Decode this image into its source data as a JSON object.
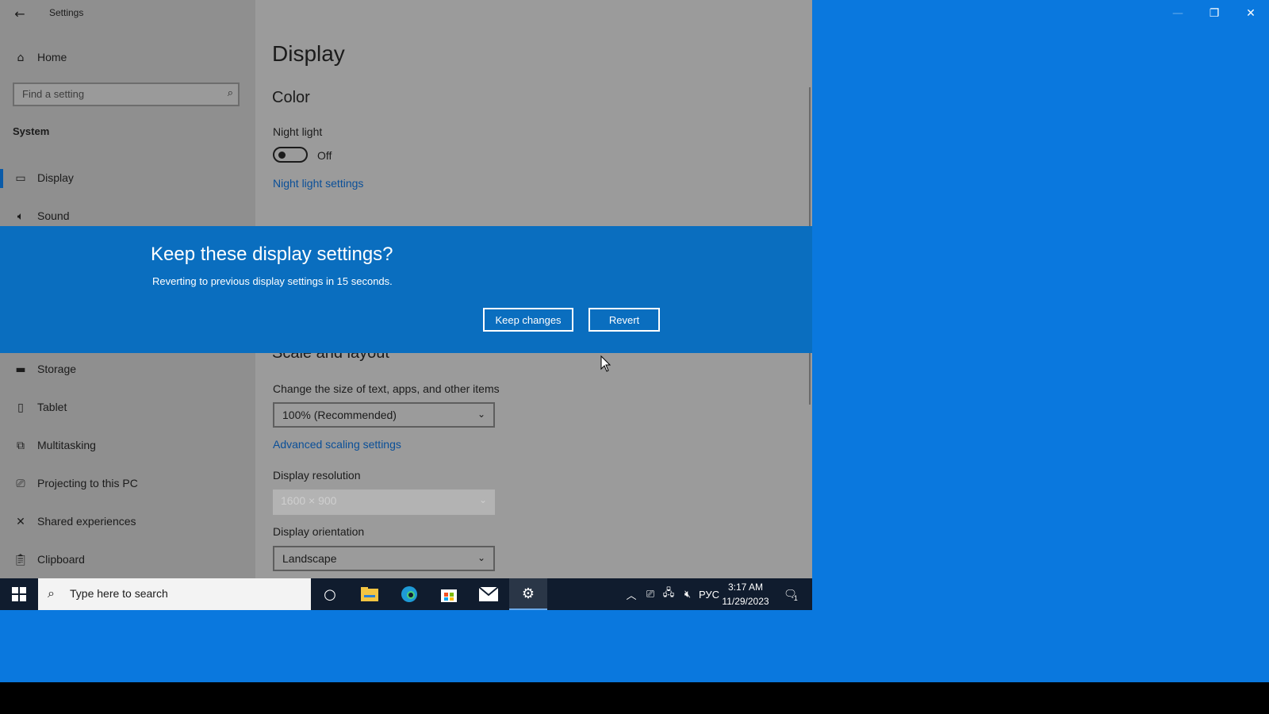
{
  "window": {
    "title": "Settings",
    "controls": {
      "minimize": "—",
      "maximize": "❐",
      "close": "✕"
    }
  },
  "sidebar": {
    "home_label": "Home",
    "search_placeholder": "Find a setting",
    "section_label": "System",
    "items": [
      {
        "label": "Display",
        "icon": "monitor-icon",
        "active": true
      },
      {
        "label": "Sound",
        "icon": "speaker-icon"
      },
      {
        "label": "Storage",
        "icon": "storage-icon"
      },
      {
        "label": "Tablet",
        "icon": "tablet-icon"
      },
      {
        "label": "Multitasking",
        "icon": "multitasking-icon"
      },
      {
        "label": "Projecting to this PC",
        "icon": "projecting-icon"
      },
      {
        "label": "Shared experiences",
        "icon": "shared-experiences-icon"
      },
      {
        "label": "Clipboard",
        "icon": "clipboard-icon"
      }
    ]
  },
  "main": {
    "page_title": "Display",
    "color_heading": "Color",
    "night_light_label": "Night light",
    "night_light_state": "Off",
    "night_light_link": "Night light settings",
    "scale_heading": "Scale and layout",
    "scale_label": "Change the size of text, apps, and other items",
    "scale_value": "100% (Recommended)",
    "advanced_scaling_link": "Advanced scaling settings",
    "resolution_label": "Display resolution",
    "resolution_value": "1600 × 900",
    "orientation_label": "Display orientation",
    "orientation_value": "Landscape"
  },
  "dialog": {
    "title": "Keep these display settings?",
    "message": "Reverting to previous display settings in 15 seconds.",
    "keep_label": "Keep changes",
    "revert_label": "Revert"
  },
  "taskbar": {
    "search_placeholder": "Type here to search",
    "apps": [
      "cortana-icon",
      "file-explorer-icon",
      "edge-icon",
      "store-icon",
      "mail-icon",
      "settings-gear-icon"
    ],
    "language": "РУС",
    "time": "3:17 AM",
    "date": "11/29/2023",
    "notification_count": "1"
  },
  "colors": {
    "desktop": "#0a78de",
    "dialog": "#0a6ebf",
    "taskbar": "#101c2e",
    "link": "#0a4f98"
  }
}
